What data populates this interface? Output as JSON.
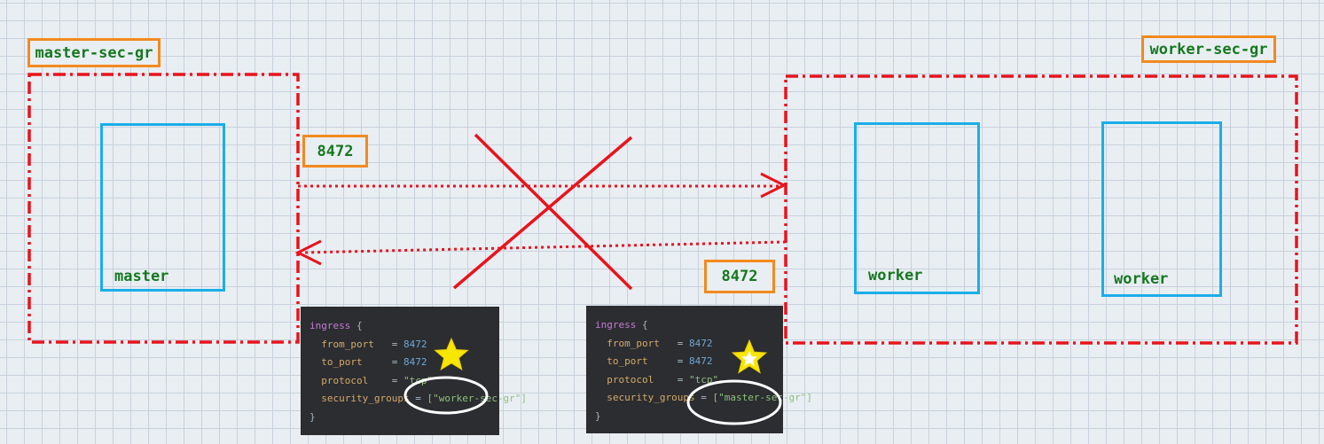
{
  "groups": {
    "master": {
      "label": "master-sec-gr"
    },
    "worker": {
      "label": "worker-sec-gr"
    }
  },
  "nodes": {
    "master": "master",
    "worker1": "worker",
    "worker2": "worker"
  },
  "ports": {
    "outbound": "8472",
    "inbound": "8472"
  },
  "code_left": {
    "block": "ingress",
    "open": "{",
    "from_port_key": "from_port",
    "from_port_val": "8472",
    "to_port_key": "to_port",
    "to_port_val": "8472",
    "protocol_key": "protocol",
    "protocol_val": "\"tcp\"",
    "sg_key": "security_groups",
    "sg_val": "[\"worker-sec-gr\"]",
    "close": "}"
  },
  "code_right": {
    "block": "ingress",
    "open": "{",
    "from_port_key": "from_port",
    "from_port_val": "8472",
    "to_port_key": "to_port",
    "to_port_val": "8472",
    "protocol_key": "protocol",
    "protocol_val": "\"tcp\"",
    "sg_key": "security_groups",
    "sg_val": "[\"master-sec-gr\"]",
    "close": "}"
  },
  "colors": {
    "group_border": "#e8141c",
    "node_border": "#1aaee8",
    "tag_border": "#f28a1e",
    "label_text": "#16781f",
    "arrow": "#e8141c",
    "cross": "#e8141c",
    "star": "#f7e600",
    "highlight_ellipse": "#ffffff"
  },
  "icons": [
    "star-icon",
    "cross-mark-icon",
    "arrow-right-icon",
    "arrow-left-icon"
  ]
}
